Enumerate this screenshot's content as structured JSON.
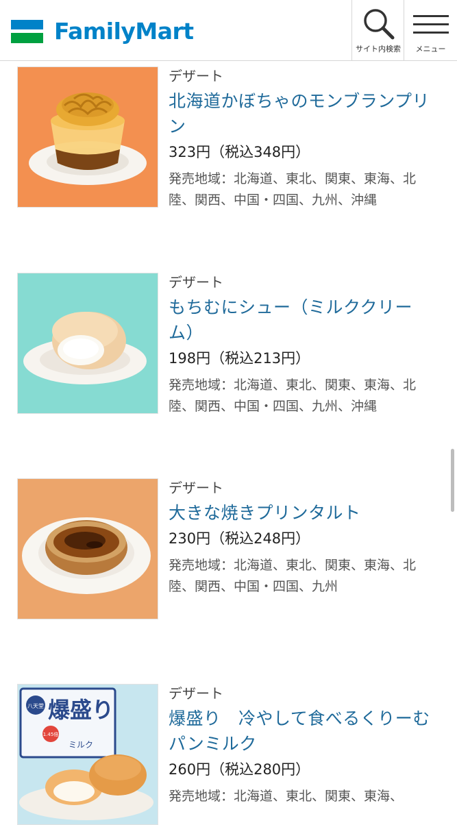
{
  "header": {
    "brand": "FamilyMart",
    "search_label": "サイト内検索",
    "menu_label": "メニュー",
    "colors": {
      "logo_blue": "#0082c8",
      "logo_green": "#00a040",
      "accent_text": "#1f6a9a"
    }
  },
  "products": [
    {
      "category": "デザート",
      "name": "北海道かぼちゃのモンブランプリン",
      "price": "323円（税込348円）",
      "area": "発売地域：北海道、東北、関東、東海、北陸、関西、中国・四国、九州、沖縄",
      "image": "pumpkin-montblanc-pudding-photo"
    },
    {
      "category": "デザート",
      "name": "もちむにシュー（ミルククリーム）",
      "price": "198円（税込213円）",
      "area": "発売地域：北海道、東北、関東、東海、北陸、関西、中国・四国、九州、沖縄",
      "image": "mochimuni-cream-puff-photo"
    },
    {
      "category": "デザート",
      "name": "大きな焼きプリンタルト",
      "price": "230円（税込248円）",
      "area": "発売地域：北海道、東北、関東、東海、北陸、関西、中国・四国、九州",
      "image": "pudding-tart-photo"
    },
    {
      "category": "デザート",
      "name": "爆盛り　冷やして食べるくりーむパンミルク",
      "price": "260円（税込280円）",
      "area": "発売地域：北海道、東北、関東、東海、",
      "image": "cream-bread-photo",
      "package_text": {
        "brand": "八天堂",
        "title": "爆盛り",
        "subtitle": "ミルク",
        "badge": "1.45倍"
      }
    }
  ]
}
